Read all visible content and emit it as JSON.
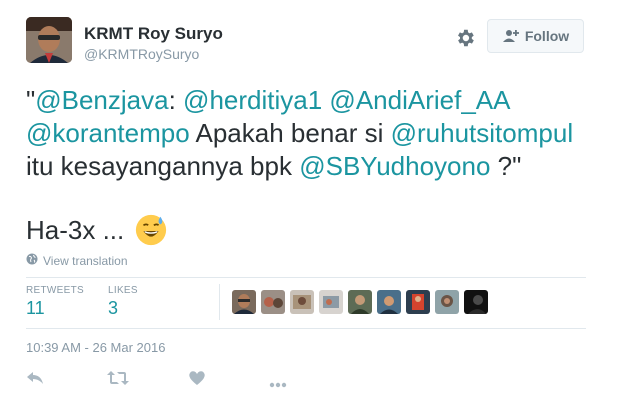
{
  "user": {
    "display_name": "KRMT Roy Suryo",
    "handle": "@KRMTRoySuryo"
  },
  "header": {
    "follow_label": "Follow",
    "settings_icon": "gear-icon",
    "follow_icon": "add-user-icon"
  },
  "tweet": {
    "quote_open": "\"",
    "mention_1": "@Benzjava",
    "colon": ": ",
    "mention_2": "@herditiya1",
    "mention_3": "@AndiArief_AA",
    "mention_4": "@korantempo",
    "text_1": " Apakah benar si ",
    "mention_5": "@ruhutsitompul",
    "text_2": "itu kesayangannya bpk ",
    "mention_6": "@SBYudhoyono",
    "text_3": " ?\"",
    "laugh": "Ha-3x ...",
    "emoji": "grinning-sweat-emoji"
  },
  "translate_label": "View translation",
  "stats": {
    "retweets_label": "RETWEETS",
    "retweets_value": "11",
    "likes_label": "LIKES",
    "likes_value": "3"
  },
  "likers_count": 9,
  "timestamp": "10:39 AM - 26 Mar 2016",
  "colors": {
    "link": "#1b95a0",
    "muted": "#8899a6",
    "text": "#292f33",
    "border": "#e1e8ed"
  }
}
